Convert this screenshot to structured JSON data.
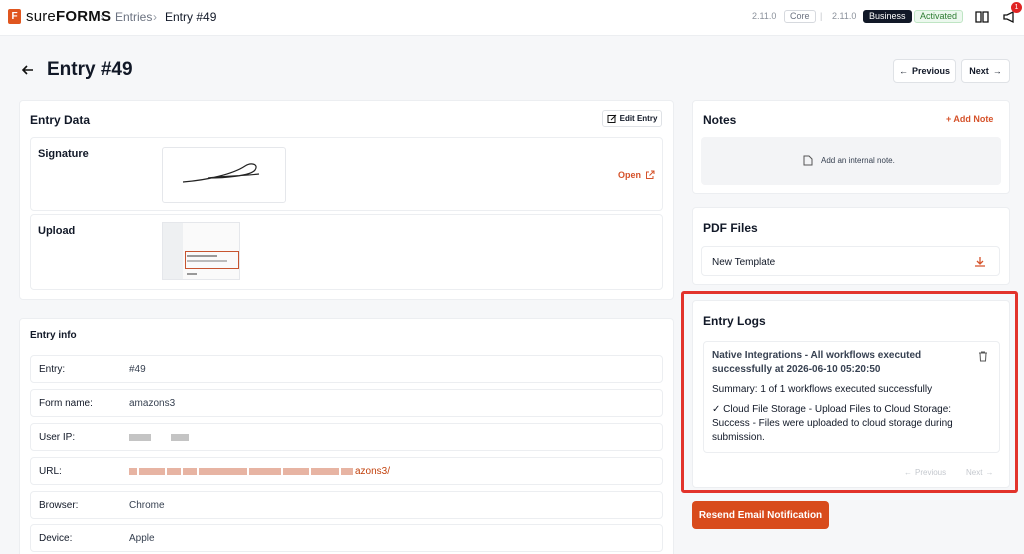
{
  "brand": {
    "logo_letter": "F",
    "name_light": "sure",
    "name_bold": "FORMS"
  },
  "breadcrumb": {
    "entries": "Entries",
    "current": "Entry #49"
  },
  "versions": {
    "core_version": "2.11.0",
    "core_label": "Core",
    "business_version": "2.11.0",
    "business_label": "Business",
    "status": "Activated"
  },
  "notifications": {
    "count": "1"
  },
  "header": {
    "title": "Entry #49",
    "previous": "Previous",
    "next": "Next"
  },
  "entry_data": {
    "title": "Entry Data",
    "edit_label": "Edit Entry",
    "signature_label": "Signature",
    "open_label": "Open",
    "upload_label": "Upload"
  },
  "entry_info": {
    "title": "Entry info",
    "rows": [
      {
        "key": "Entry:",
        "value": "#49"
      },
      {
        "key": "Form name:",
        "value": "amazons3"
      },
      {
        "key": "User IP:",
        "value": ""
      },
      {
        "key": "URL:",
        "value": "azons3/"
      },
      {
        "key": "Browser:",
        "value": "Chrome"
      },
      {
        "key": "Device:",
        "value": "Apple"
      }
    ]
  },
  "notes": {
    "title": "Notes",
    "add_label": "+ Add Note",
    "empty_text": "Add an internal note."
  },
  "pdf": {
    "title": "PDF Files",
    "template_name": "New Template"
  },
  "logs": {
    "title": "Entry Logs",
    "entry_title": "Native Integrations - All workflows executed successfully at 2026-06-10 05:20:50",
    "summary": "Summary: 1 of 1 workflows executed successfully",
    "detail": "✓ Cloud File Storage - Upload Files to Cloud Storage: Success - Files were uploaded to cloud storage during submission.",
    "previous": "Previous",
    "next": "Next"
  },
  "actions": {
    "resend": "Resend Email Notification"
  },
  "colors": {
    "accent": "#d84b1c",
    "highlight_border": "#e2332b",
    "activated": "#2e7d32"
  }
}
